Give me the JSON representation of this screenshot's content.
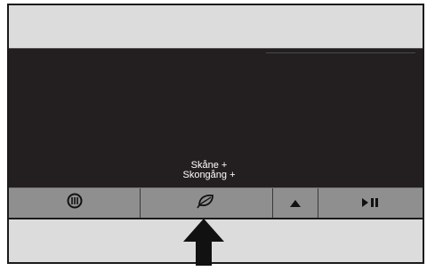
{
  "display": {
    "hint_line1": "Skåne +",
    "hint_line2": "Skongång +"
  },
  "buttons": [
    {
      "name": "heat-zone-button",
      "icon": "heat-coil-icon"
    },
    {
      "name": "eco-leaf-button",
      "icon": "leaf-icon"
    },
    {
      "name": "up-arrow-button",
      "icon": "triangle-up-icon"
    },
    {
      "name": "play-pause-button",
      "icon": "play-pause-icon"
    }
  ],
  "pointer": {
    "icon": "pointer-arrow-icon",
    "target": "eco-leaf-button"
  },
  "colors": {
    "panel": "#dcdcdc",
    "display": "#231f20",
    "button_bar": "#8f8f8f",
    "text": "#ffffff",
    "icon": "#111111"
  }
}
